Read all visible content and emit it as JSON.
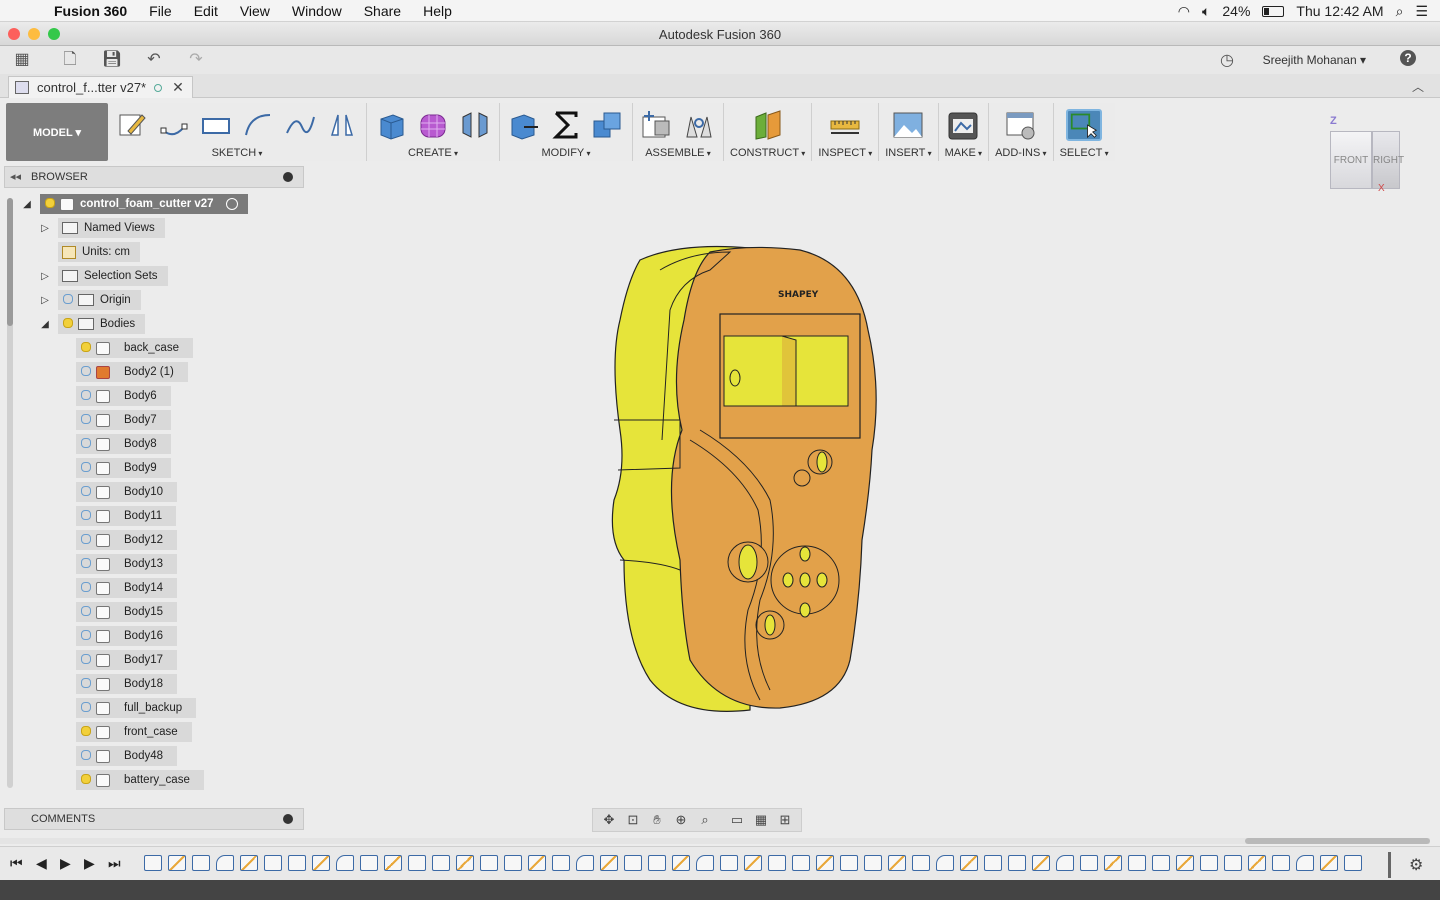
{
  "menubar": {
    "app": "Fusion 360",
    "menus": [
      "File",
      "Edit",
      "View",
      "Window",
      "Share",
      "Help"
    ],
    "battery": "24%",
    "time": "Thu 12:42 AM"
  },
  "window": {
    "title": "Autodesk Fusion 360"
  },
  "quickbar": {
    "user": "Sreejith Mohanan ▾"
  },
  "document": {
    "tab": "control_f...tter v27*"
  },
  "ribbon": {
    "workspace": "MODEL ▾",
    "groups": [
      "SKETCH",
      "CREATE",
      "MODIFY",
      "ASSEMBLE",
      "CONSTRUCT",
      "INSPECT",
      "INSERT",
      "MAKE",
      "ADD-INS",
      "SELECT"
    ]
  },
  "viewcube": {
    "front": "FRONT",
    "right": "RIGHT",
    "z": "Z",
    "x": "X"
  },
  "browser": {
    "title": "BROWSER",
    "root": "control_foam_cutter v27",
    "nodes": {
      "named_views": "Named Views",
      "units": "Units: cm",
      "selection_sets": "Selection Sets",
      "origin": "Origin",
      "bodies": "Bodies"
    },
    "bodies": [
      "back_case",
      "Body2 (1)",
      "Body6",
      "Body7",
      "Body8",
      "Body9",
      "Body10",
      "Body11",
      "Body12",
      "Body13",
      "Body14",
      "Body15",
      "Body16",
      "Body17",
      "Body18",
      "full_backup",
      "front_case",
      "Body48",
      "battery_case"
    ]
  },
  "comments": {
    "title": "COMMENTS"
  },
  "model": {
    "label": "SHAPEY"
  },
  "colors": {
    "accent": "#4b87b8",
    "case_front": "#e2a14a",
    "case_back": "#e6e43a"
  }
}
